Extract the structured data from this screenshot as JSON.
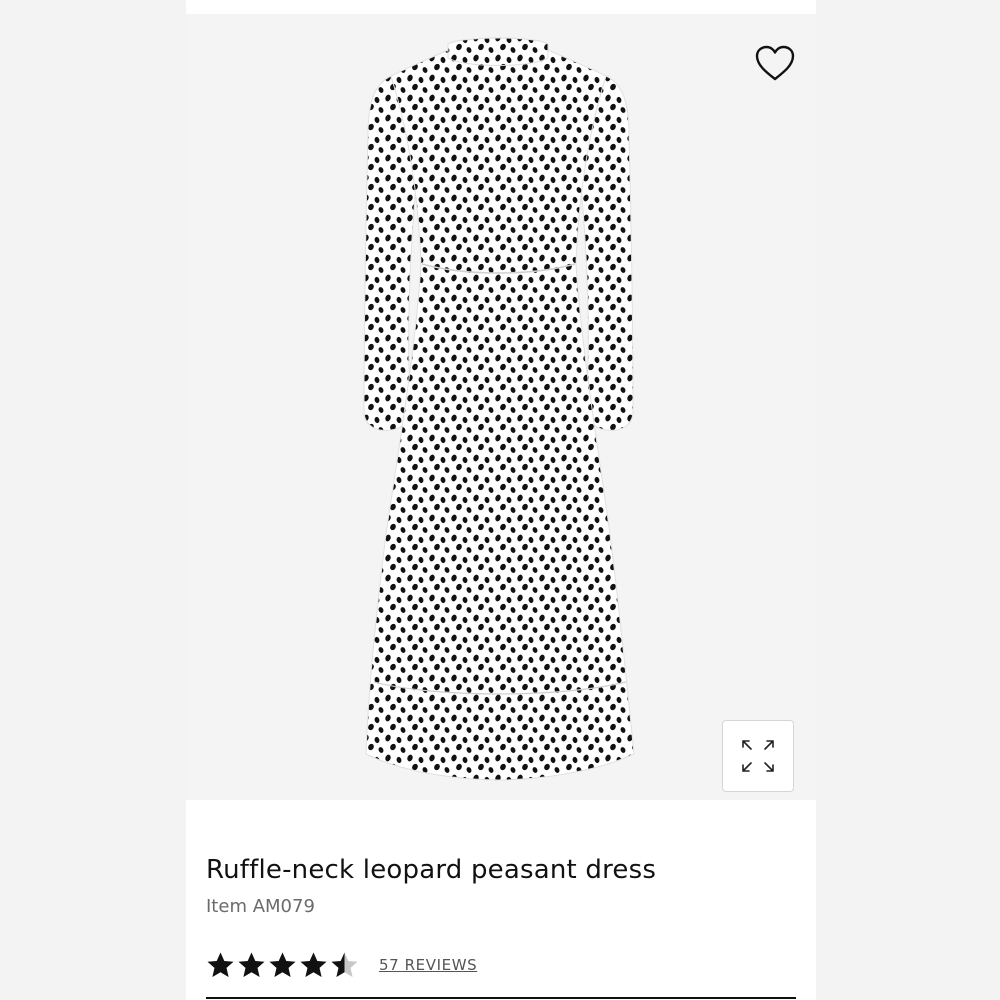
{
  "product": {
    "title": "Ruffle-neck leopard peasant dress",
    "item_number": "Item AM079",
    "rating": 4.5,
    "rating_max": 5,
    "reviews_label": "57 REVIEWS"
  },
  "icons": {
    "wishlist": "heart-outline-icon",
    "expand": "expand-arrows-icon",
    "star": "star-icon"
  },
  "colors": {
    "dress_spots": "#111111",
    "dress_base": "#ffffff",
    "text_primary": "#111111",
    "text_secondary": "#6b6b6b"
  }
}
